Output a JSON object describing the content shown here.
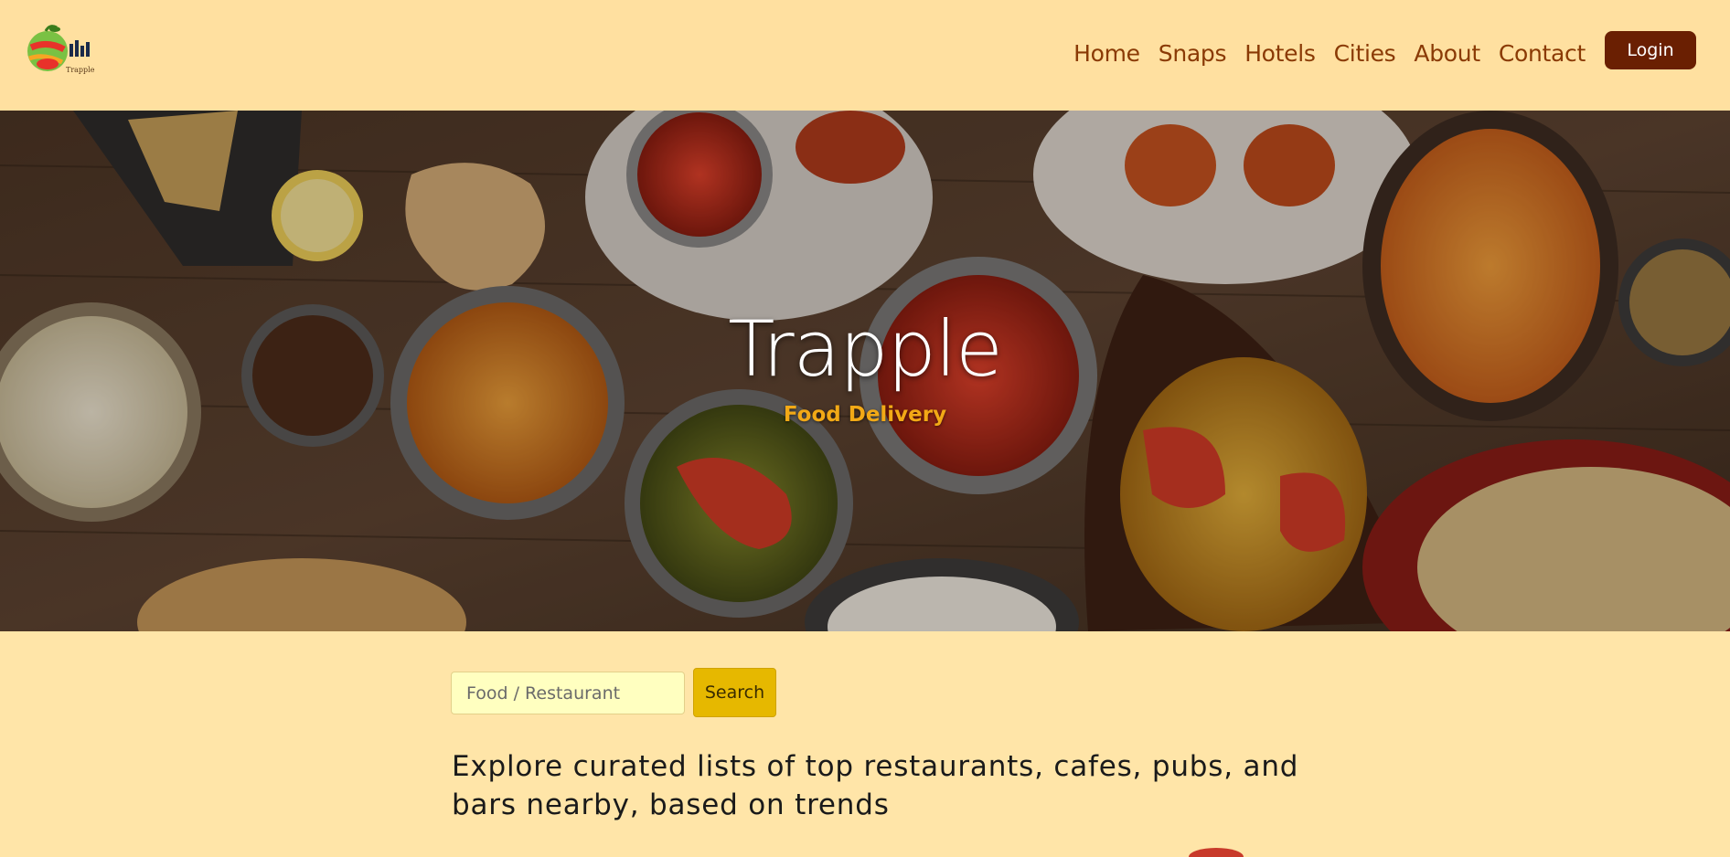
{
  "brand": {
    "logo_icon": "apple-logo-icon",
    "logo_text": "Trapple"
  },
  "nav": {
    "items": [
      {
        "label": "Home"
      },
      {
        "label": "Snaps"
      },
      {
        "label": "Hotels"
      },
      {
        "label": "Cities"
      },
      {
        "label": "About"
      },
      {
        "label": "Contact"
      }
    ],
    "login_label": "Login"
  },
  "hero": {
    "title": "Trapple",
    "subtitle": "Food Delivery",
    "background": "indian-food-spread-photo"
  },
  "search": {
    "placeholder": "Food / Restaurant",
    "value": "",
    "button_label": "Search"
  },
  "tagline": "Explore curated lists of top restaurants, cafes, pubs, and bars nearby, based on trends",
  "colors": {
    "page_bg": "#ffe5a8",
    "nav_text": "#8a3a05",
    "login_bg": "#6a1f02",
    "accent": "#f2a916",
    "search_button": "#e6b800"
  }
}
